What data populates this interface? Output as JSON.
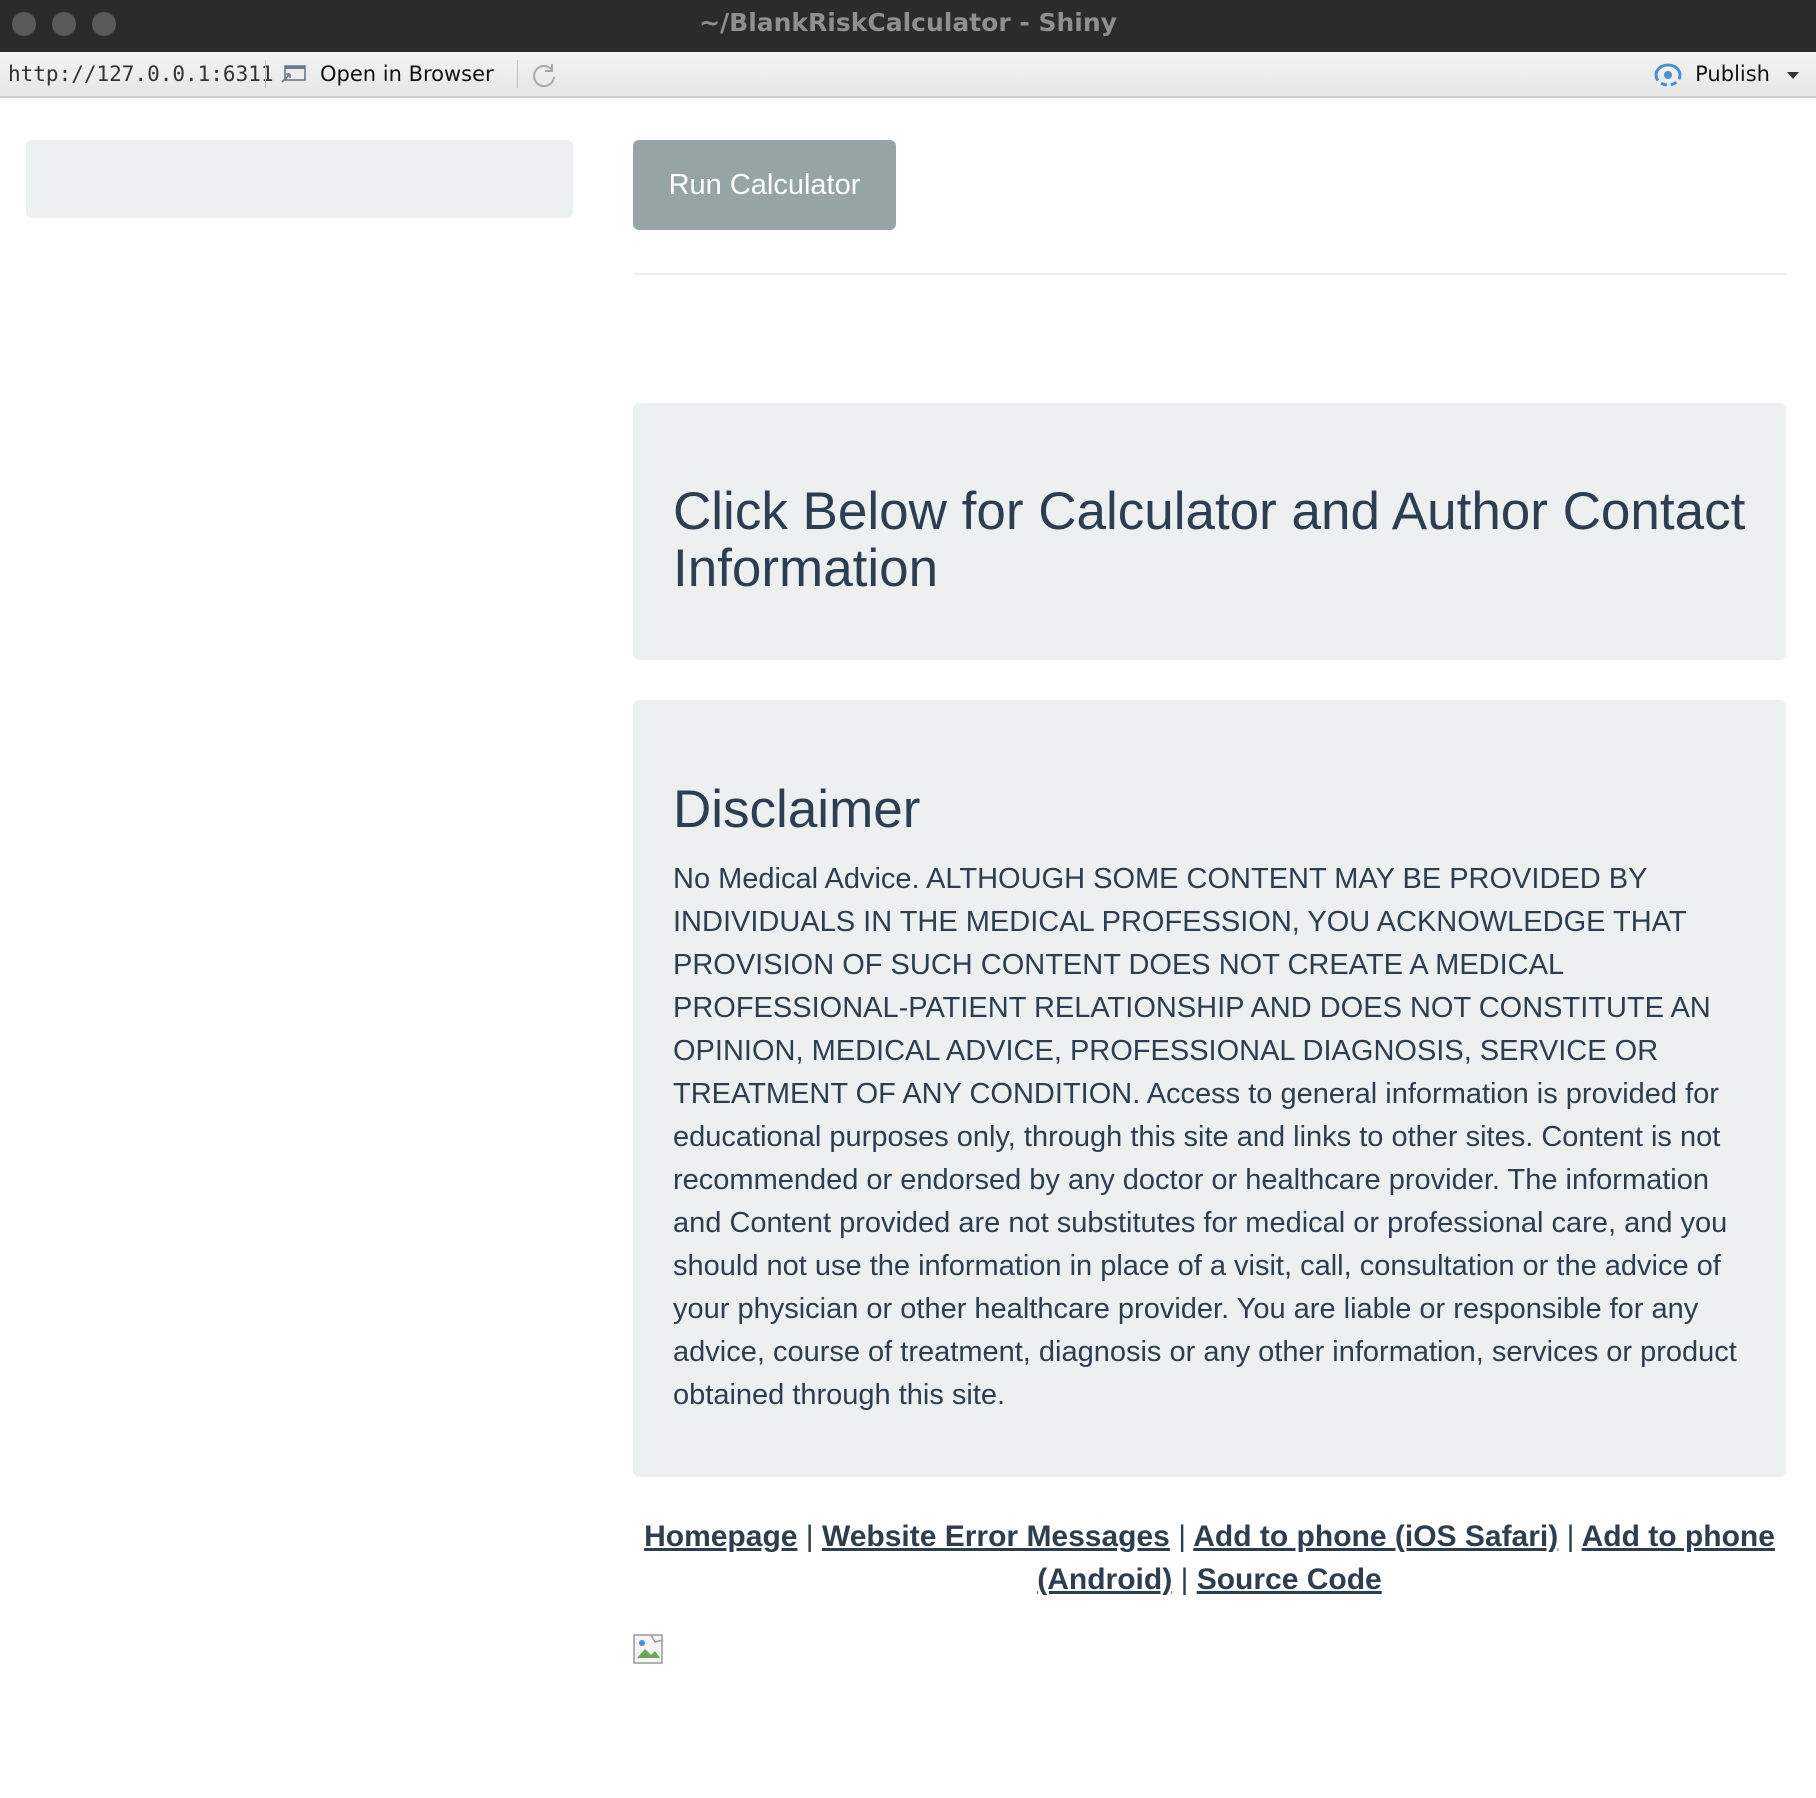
{
  "window": {
    "title": "~/BlankRiskCalculator - Shiny"
  },
  "toolbar": {
    "url": "http://127.0.0.1:6311",
    "open_in_browser_label": "Open in Browser",
    "publish_label": "Publish",
    "icons": [
      "browser-icon",
      "refresh-icon",
      "publish-icon",
      "chevron-down-icon"
    ]
  },
  "main": {
    "run_button_label": "Run Calculator",
    "info_heading": "Click Below for Calculator and Author Contact Information",
    "disclaimer_heading": "Disclaimer",
    "disclaimer_text": "No Medical Advice. ALTHOUGH SOME CONTENT MAY BE PROVIDED BY INDIVIDUALS IN THE MEDICAL PROFESSION, YOU ACKNOWLEDGE THAT PROVISION OF SUCH CONTENT DOES NOT CREATE A MEDICAL PROFESSIONAL-PATIENT RELATIONSHIP AND DOES NOT CONSTITUTE AN OPINION, MEDICAL ADVICE, PROFESSIONAL DIAGNOSIS, SERVICE OR TREATMENT OF ANY CONDITION. Access to general information is provided for educational purposes only, through this site and links to other sites. Content is not recommended or endorsed by any doctor or healthcare provider. The information and Content provided are not substitutes for medical or professional care, and you should not use the information in place of a visit, call, consultation or the advice of your physician or other healthcare provider. You are liable or responsible for any advice, course of treatment, diagnosis or any other information, services or product obtained through this site."
  },
  "footer": {
    "separator": "|",
    "links": [
      "Homepage",
      "Website Error Messages",
      "Add to phone (iOS Safari)",
      "Add to phone (Android)",
      "Source Code"
    ]
  },
  "colors": {
    "well_bg": "#ecf0f1",
    "button_bg": "#95a5a6",
    "text": "#2c3e50",
    "titlebar_bg": "#2b2b2b"
  }
}
